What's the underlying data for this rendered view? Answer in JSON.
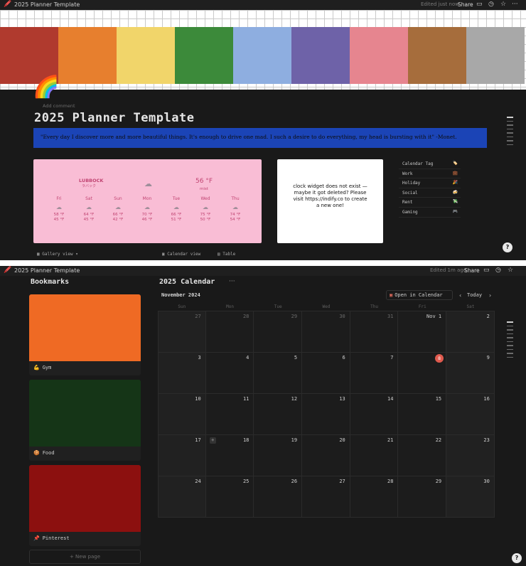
{
  "window_top": {
    "tab_emoji": "🖍️",
    "tab_title": "2025 Planner Template",
    "edited": "Edited just now",
    "share": "Share",
    "banner_tiles": [
      "#b03a2e",
      "#e77f2e",
      "#f1d56a",
      "#3c8a3a",
      "#8eaee0",
      "#6e62a8",
      "#e6858f",
      "#a66d3c",
      "#a8a8a8"
    ],
    "icon_emoji": "🌈",
    "add_comment": "Add comment",
    "page_title": "2025 Planner Template",
    "quote": "\"Every day I discover more and more beautiful things. It's enough to drive one mad. I such a desire to do everything, my head is bursting with it\" -Monet.",
    "quote_bg": "#1b44b6",
    "weather": {
      "city": "LUBBOCK",
      "city_sub": "ラバック",
      "temp": "56 °F",
      "desc": "mist",
      "days": [
        {
          "name": "Fri",
          "hi": "58 °F",
          "lo": "45 °F"
        },
        {
          "name": "Sat",
          "hi": "64 °F",
          "lo": "45 °F"
        },
        {
          "name": "Sun",
          "hi": "66 °F",
          "lo": "42 °F"
        },
        {
          "name": "Mon",
          "hi": "70 °F",
          "lo": "46 °F"
        },
        {
          "name": "Tue",
          "hi": "66 °F",
          "lo": "51 °F"
        },
        {
          "name": "Wed",
          "hi": "75 °F",
          "lo": "50 °F"
        },
        {
          "name": "Thu",
          "hi": "74 °F",
          "lo": "54 °F"
        }
      ]
    },
    "clock_text": "clock widget does not exist — maybe it got deleted? Please visit https://indify.co to create a new one!",
    "legend": [
      {
        "label": "Calendar Tag",
        "icon": "🏷️"
      },
      {
        "label": "Work",
        "icon": "💼"
      },
      {
        "label": "Holiday",
        "icon": "🎉"
      },
      {
        "label": "Social",
        "icon": "🍻"
      },
      {
        "label": "Rent",
        "icon": "💸"
      },
      {
        "label": "Gaming",
        "icon": "🎮"
      }
    ],
    "views": {
      "gallery": "Gallery view",
      "calendar": "Calendar view",
      "table": "Table"
    }
  },
  "window_bottom": {
    "tab_emoji": "🖍️",
    "tab_title": "2025 Planner Template",
    "edited": "Edited 1m ago",
    "share": "Share",
    "bookmarks_title": "Bookmarks",
    "bookmarks": [
      {
        "label": "Gym",
        "icon": "💪",
        "color": "#ef6a24"
      },
      {
        "label": "Food",
        "icon": "🍪",
        "color": "#153517"
      },
      {
        "label": "Pinterest",
        "icon": "📌",
        "color": "#8c100f"
      }
    ],
    "new_page": "+ New page",
    "calendar_title": "2025 Calendar",
    "more": "···",
    "month": "November 2024",
    "open_in_calendar": "Open in Calendar",
    "today": "Today",
    "weekdays": [
      "Sun",
      "Mon",
      "Tue",
      "Wed",
      "Thu",
      "Fri",
      "Sat"
    ],
    "weeks": [
      [
        "27",
        "28",
        "29",
        "30",
        "31",
        "Nov 1",
        "2"
      ],
      [
        "3",
        "4",
        "5",
        "6",
        "7",
        "8",
        "9"
      ],
      [
        "10",
        "11",
        "12",
        "13",
        "14",
        "15",
        "16"
      ],
      [
        "17",
        "18",
        "19",
        "20",
        "21",
        "22",
        "23"
      ],
      [
        "24",
        "25",
        "26",
        "27",
        "28",
        "29",
        "30"
      ]
    ],
    "today_date": "8"
  }
}
